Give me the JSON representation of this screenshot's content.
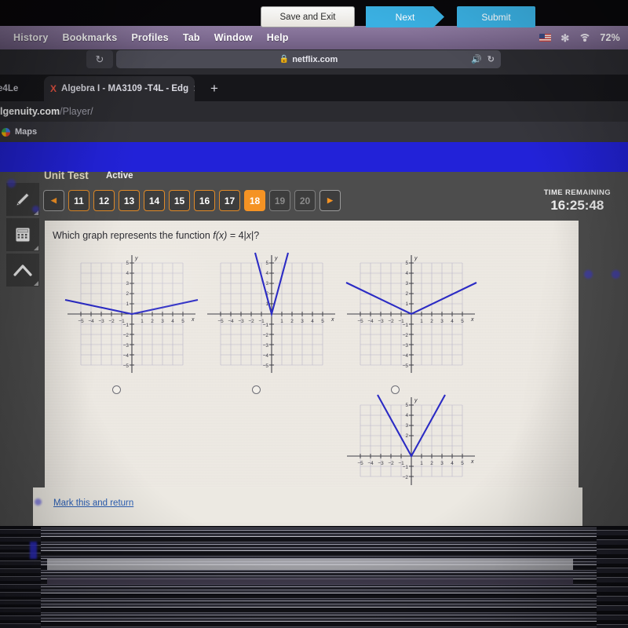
{
  "menu_bar": {
    "items": [
      "History",
      "Bookmarks",
      "Profiles",
      "Tab",
      "Window",
      "Help"
    ],
    "battery_percent": "72%",
    "icons": [
      "flag-icon",
      "bluetooth-icon",
      "wifi-icon"
    ]
  },
  "browser": {
    "url_display": "netflix.com",
    "reload_glyph": "↻",
    "lock_glyph": "🔒",
    "speaker_glyph": "🔊",
    "tabs": [
      {
        "title": "ne4Le",
        "favicon": ""
      },
      {
        "title": "Algebra I - MA3109 -T4L - Edg",
        "favicon": "X"
      }
    ],
    "new_tab_glyph": "+",
    "address": {
      "domain": "lgenuity.com",
      "path": "/Player/"
    },
    "bookmarks": [
      "Maps"
    ]
  },
  "app": {
    "unit_label": "Unit Test",
    "status_label": "Active",
    "tools": [
      {
        "name": "highlighter-tool",
        "glyph": "✎"
      },
      {
        "name": "calculator-tool",
        "glyph": "⌸"
      },
      {
        "name": "arrow-up-tool",
        "glyph": "↑"
      }
    ],
    "pager": {
      "prev_glyph": "◀",
      "next_glyph": "▶",
      "pages": [
        {
          "label": "11",
          "state": "done"
        },
        {
          "label": "12",
          "state": "done"
        },
        {
          "label": "13",
          "state": "done"
        },
        {
          "label": "14",
          "state": "done"
        },
        {
          "label": "15",
          "state": "done"
        },
        {
          "label": "16",
          "state": "done"
        },
        {
          "label": "17",
          "state": "done"
        },
        {
          "label": "18",
          "state": "current"
        },
        {
          "label": "19",
          "state": "locked"
        },
        {
          "label": "20",
          "state": "locked"
        }
      ]
    },
    "timer": {
      "label": "TIME REMAINING",
      "value": "16:25:48"
    },
    "question": {
      "prompt_prefix": "Which graph represents the function ",
      "prompt_fx": "f(x)",
      "prompt_eq": " = 4|",
      "prompt_x": "x",
      "prompt_suffix": "|?"
    },
    "actions": {
      "mark_link": "Mark this and return",
      "save_label": "Save and Exit",
      "next_label": "Next",
      "submit_label": "Submit"
    },
    "colors": {
      "accent_orange": "#f59324",
      "blue_bar": "#2222d8",
      "button_blue": "#3ab0e2",
      "graph_line": "#2b2bc4"
    }
  },
  "chart_data": [
    {
      "id": "choice-a",
      "type": "line",
      "title": "Choice A graph",
      "function": "y = 0.25|x|",
      "slope": 0.25,
      "xlabel": "x",
      "ylabel": "y",
      "xlim": [
        -5,
        5
      ],
      "ylim": [
        -5,
        5
      ],
      "xticks": [
        -5,
        -4,
        -3,
        -2,
        -1,
        1,
        2,
        3,
        4,
        5
      ],
      "yticks": [
        5,
        4,
        3,
        2,
        1,
        -1,
        -2,
        -3,
        -4,
        -5
      ],
      "x": [
        -5.6,
        0,
        5.6
      ],
      "y": [
        1.4,
        0,
        1.4
      ],
      "grid": true,
      "legend": "none"
    },
    {
      "id": "choice-b",
      "type": "line",
      "title": "Choice B graph",
      "function": "y = 4|x|",
      "slope": 4,
      "xlabel": "x",
      "ylabel": "y",
      "xlim": [
        -5,
        5
      ],
      "ylim": [
        -5,
        5
      ],
      "xticks": [
        -5,
        -4,
        -3,
        -2,
        -1,
        1,
        2,
        3,
        4,
        5
      ],
      "yticks": [
        5,
        4,
        3,
        2,
        1,
        -1,
        -2,
        -3,
        -4,
        -5
      ],
      "x": [
        -1.7,
        0,
        1.7
      ],
      "y": [
        6.8,
        0,
        6.8
      ],
      "grid": true,
      "legend": "none"
    },
    {
      "id": "choice-c",
      "type": "line",
      "title": "Choice C graph",
      "function": "y = 0.6|x|",
      "slope": 0.6,
      "xlabel": "x",
      "ylabel": "y",
      "xlim": [
        -5,
        5
      ],
      "ylim": [
        -5,
        5
      ],
      "xticks": [
        -5,
        -4,
        -3,
        -2,
        -1,
        1,
        2,
        3,
        4,
        5
      ],
      "yticks": [
        5,
        4,
        3,
        2,
        1,
        -1,
        -2,
        -3,
        -4,
        -5
      ],
      "x": [
        -5.2,
        0,
        5.2
      ],
      "y": [
        3.1,
        0,
        3.1
      ],
      "grid": true,
      "legend": "none"
    },
    {
      "id": "choice-d",
      "type": "line",
      "title": "Choice D graph",
      "function": "y = 2|x|",
      "slope": 2,
      "xlabel": "x",
      "ylabel": "y",
      "xlim": [
        -5,
        5
      ],
      "ylim": [
        -2,
        5
      ],
      "xticks": [
        -5,
        -4,
        -3,
        -2,
        -1,
        1,
        2,
        3,
        4,
        5
      ],
      "yticks": [
        5,
        4,
        3,
        2,
        -1,
        -2
      ],
      "x": [
        -3.3,
        0,
        3.3
      ],
      "y": [
        6.6,
        0,
        6.6
      ],
      "grid": true,
      "legend": "none"
    }
  ]
}
